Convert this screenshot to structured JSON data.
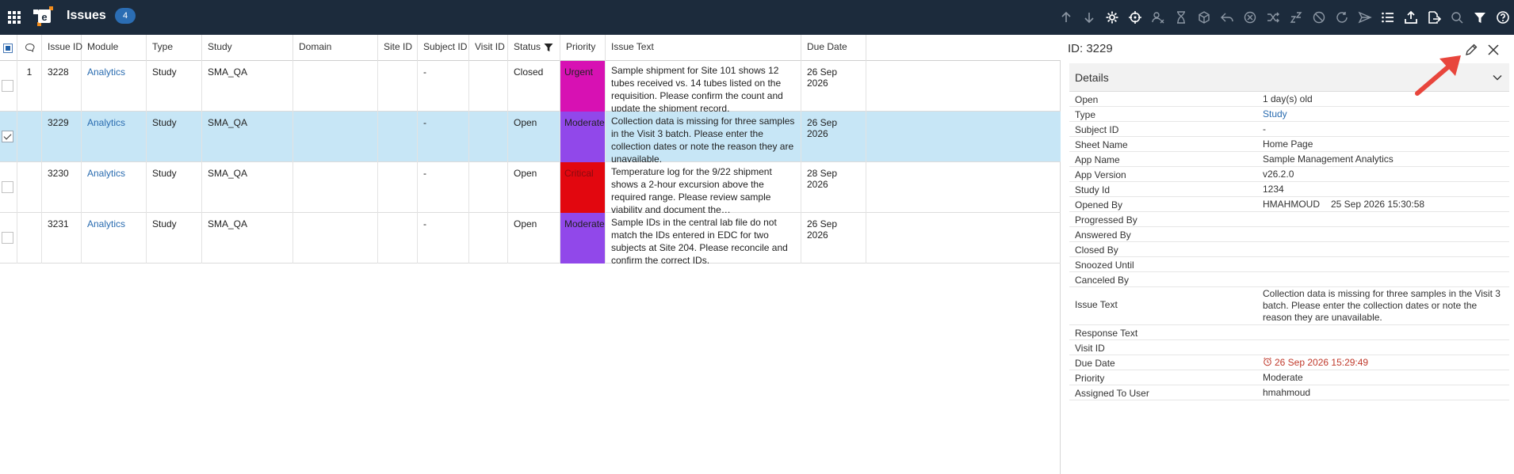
{
  "header": {
    "title": "Issues",
    "count": "4"
  },
  "toolbar_icons": [
    "arrow-up-icon",
    "arrow-down-icon",
    "settings-icon",
    "target-icon",
    "user-remove-icon",
    "hourglass-icon",
    "cube-icon",
    "reply-icon",
    "cancel-circle-icon",
    "shuffle-icon",
    "snooze-icon",
    "block-icon",
    "refresh-icon",
    "send-icon",
    "list-icon",
    "export-icon",
    "document-export-icon",
    "search-icon",
    "filter-icon",
    "help-icon"
  ],
  "grid": {
    "columns": {
      "issue_id": "Issue ID",
      "module": "Module",
      "type": "Type",
      "study": "Study",
      "domain": "Domain",
      "site_id": "Site ID",
      "subject_id": "Subject ID",
      "visit_id": "Visit ID",
      "status": "Status",
      "priority": "Priority",
      "issue_text": "Issue Text",
      "due_date": "Due Date"
    },
    "rows": [
      {
        "comments": "1",
        "checked": false,
        "issue_id": "3228",
        "module": "Analytics",
        "type": "Study",
        "study": "SMA_QA",
        "domain": "",
        "site_id": "",
        "subject_id": "-",
        "visit_id": "",
        "status": "Closed",
        "priority": "Urgent",
        "issue_text": "Sample shipment for Site 101 shows 12 tubes received vs. 14 tubes listed on the requisition. Please confirm the count and update the shipment record.",
        "due_date": "26 Sep 2026"
      },
      {
        "comments": "",
        "checked": true,
        "issue_id": "3229",
        "module": "Analytics",
        "type": "Study",
        "study": "SMA_QA",
        "domain": "",
        "site_id": "",
        "subject_id": "-",
        "visit_id": "",
        "status": "Open",
        "priority": "Moderate",
        "issue_text": "Collection data is missing for three samples in the Visit 3 batch. Please enter the collection dates or note the reason they are unavailable.",
        "due_date": "26 Sep 2026"
      },
      {
        "comments": "",
        "checked": false,
        "issue_id": "3230",
        "module": "Analytics",
        "type": "Study",
        "study": "SMA_QA",
        "domain": "",
        "site_id": "",
        "subject_id": "-",
        "visit_id": "",
        "status": "Open",
        "priority": "Critical",
        "issue_text": "Temperature log for the 9/22 shipment shows a 2-hour excursion above the required range. Please review sample viability and document the…",
        "due_date": "28 Sep 2026"
      },
      {
        "comments": "",
        "checked": false,
        "issue_id": "3231",
        "module": "Analytics",
        "type": "Study",
        "study": "SMA_QA",
        "domain": "",
        "site_id": "",
        "subject_id": "-",
        "visit_id": "",
        "status": "Open",
        "priority": "Moderate",
        "issue_text": "Sample IDs in the central lab file do not match the IDs entered in EDC for two subjects at Site 204. Please reconcile and confirm the correct IDs.",
        "due_date": "26 Sep 2026"
      }
    ]
  },
  "colors": {
    "topbar": "#1c2b3c",
    "selected_row": "#c7e6f6",
    "urgent": "#d711b3",
    "moderate": "#9148ea",
    "critical": "#e2070f",
    "link": "#2a6cb0",
    "annotation_arrow": "#e8453c"
  },
  "details": {
    "id_label": "ID: 3229",
    "section_title": "Details",
    "fields": [
      {
        "label": "Open",
        "value": "1 day(s) old"
      },
      {
        "label": "Type",
        "value": "Study"
      },
      {
        "label": "Subject ID",
        "value": "-"
      },
      {
        "label": "Sheet Name",
        "value": "Home Page"
      },
      {
        "label": "App Name",
        "value": "Sample Management Analytics"
      },
      {
        "label": "App Version",
        "value": "v26.2.0"
      },
      {
        "label": "Study Id",
        "value": "1234"
      },
      {
        "label": "Opened By",
        "value": "HMAHMOUD",
        "value2": "25 Sep 2026 15:30:58"
      },
      {
        "label": "Progressed By",
        "value": ""
      },
      {
        "label": "Answered By",
        "value": ""
      },
      {
        "label": "Closed By",
        "value": ""
      },
      {
        "label": "Snoozed Until",
        "value": ""
      },
      {
        "label": "Canceled By",
        "value": ""
      },
      {
        "label": "Issue Text",
        "value": "Collection data is missing for three samples in the Visit 3 batch. Please enter the collection dates or note the reason they are unavailable."
      },
      {
        "label": "Response Text",
        "value": ""
      },
      {
        "label": "Visit ID",
        "value": ""
      },
      {
        "label": "Due Date",
        "value": "26 Sep 2026 15:29:49"
      },
      {
        "label": "Priority",
        "value": "Moderate"
      },
      {
        "label": "Assigned To User",
        "value": "hmahmoud"
      }
    ]
  }
}
